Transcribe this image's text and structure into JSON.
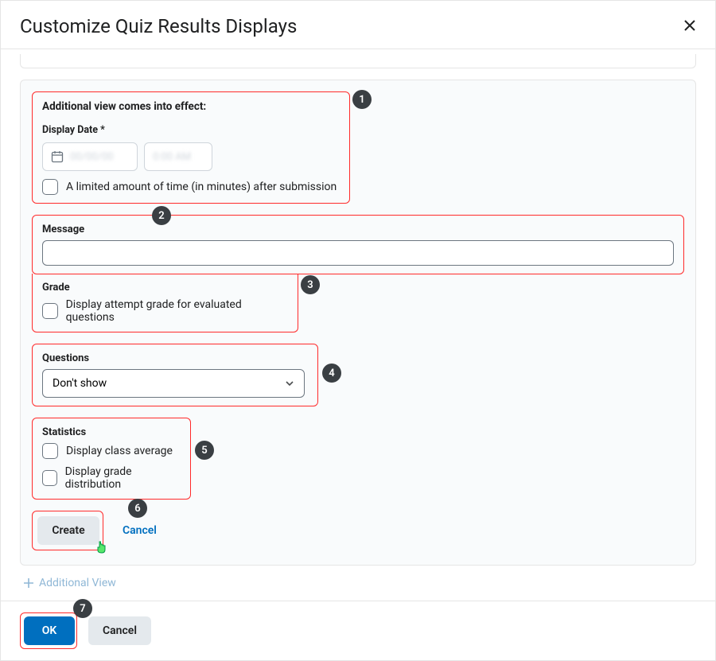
{
  "dialog": {
    "title": "Customize Quiz Results Displays"
  },
  "callouts": {
    "c1": "1",
    "c2": "2",
    "c3": "3",
    "c4": "4",
    "c5": "5",
    "c6": "6",
    "c7": "7"
  },
  "section1": {
    "heading": "Additional view comes into effect:",
    "display_date_label": "Display Date *",
    "limited_time_label": "A limited amount of time (in minutes) after submission"
  },
  "section2": {
    "heading": "Message"
  },
  "section3": {
    "heading": "Grade",
    "grade_checkbox_label": "Display attempt grade for evaluated questions"
  },
  "section4": {
    "heading": "Questions",
    "select_value": "Don't show"
  },
  "section5": {
    "heading": "Statistics",
    "class_avg_label": "Display class average",
    "grade_dist_label": "Display grade distribution"
  },
  "section6": {
    "create_label": "Create",
    "cancel_label": "Cancel"
  },
  "additional_view_label": "Additional View",
  "footer": {
    "ok_label": "OK",
    "cancel_label": "Cancel"
  }
}
